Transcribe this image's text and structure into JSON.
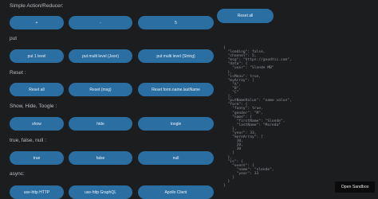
{
  "sections": {
    "simple": {
      "label": "Simple Action/Reducer:",
      "buttons": [
        "+",
        "-",
        "5"
      ]
    },
    "put": {
      "label": "put",
      "buttons": [
        "put 1 level",
        "put multi level (Json)",
        "put multi level (String)"
      ]
    },
    "reset": {
      "label": "Reset :",
      "buttons": [
        "Reset all",
        "Reset (msg)",
        "Reset form.name.lastName"
      ]
    },
    "toggle": {
      "label": "Show, Hide, Toogle :",
      "buttons": [
        "show",
        "hide",
        "toogle"
      ]
    },
    "bool": {
      "label": "true, false, null :",
      "buttons": [
        "true",
        "false",
        "null"
      ]
    },
    "async": {
      "label": "async:",
      "buttons": [
        "use-http HTTP",
        "use-http GraphQL",
        "Apollo Client"
      ]
    }
  },
  "top_reset_all": "Reset all",
  "state_json": "{\n  \"loading\": false,\n  \"channel\": 5,\n  \"msg\": \"https://goodtic.com\",\n  \"data\": {\n    \"user\": \"Slonde MB\"\n  },\n  \"isMenu\": true,\n  \"myArray\": [\n    \"A\",\n    \"B\",\n    \"C\"\n  ],\n  \"putNameValue\": \"name value\",\n  \"form\": {\n    \"funny\": true,\n    \"gender\": \"M\",\n    \"name\": {\n      \"firstName\": \"Slonde\",\n      \"lastName\": \"Moreda\"\n    },\n    \"year\": 33,\n    \"moreArray\": [\n      10,\n      20,\n      30\n    ]\n  },\n  \"is\": {\n    \"event\": {\n      \"name\": \"slonde\",\n      \"year\": 33\n    }\n  }\n}",
  "open_sandbox": "Open Sandbox"
}
